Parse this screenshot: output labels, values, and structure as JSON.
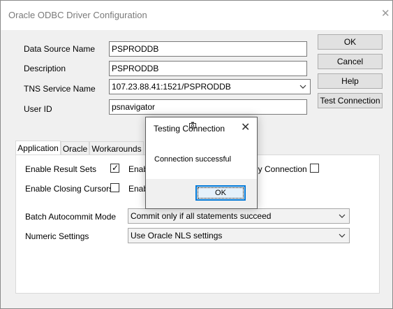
{
  "window": {
    "title": "Oracle ODBC Driver Configuration",
    "close_glyph": "✕"
  },
  "fields": {
    "data_source_name": {
      "label": "Data Source Name",
      "value": "PSPRODDB"
    },
    "description": {
      "label": "Description",
      "value": "PSPRODDB"
    },
    "tns_service_name": {
      "label": "TNS Service Name",
      "value": "107.23.88.41:1521/PSPRODDB"
    },
    "user_id": {
      "label": "User ID",
      "value": "psnavigator"
    }
  },
  "buttons": {
    "ok": "OK",
    "cancel": "Cancel",
    "help": "Help",
    "test_connection": "Test Connection"
  },
  "tabs": [
    {
      "label": "Application",
      "active": true
    },
    {
      "label": "Oracle"
    },
    {
      "label": "Workarounds"
    }
  ],
  "application": {
    "enable_result_sets": {
      "label": "Enable Result Sets",
      "checked": true
    },
    "enable_closing_cursors": {
      "label": "Enable Closing Cursors",
      "checked": false
    },
    "enab_1": "Enab",
    "enab_2": "Enab",
    "ly_connection": {
      "label": "ly Connection",
      "checked": false
    },
    "batch_autocommit": {
      "label": "Batch Autocommit Mode",
      "value": "Commit only if all statements succeed"
    },
    "numeric_settings": {
      "label": "Numeric Settings",
      "value": "Use Oracle NLS settings"
    }
  },
  "dialog": {
    "title": "Testing Connection",
    "message": "Connection successful",
    "ok_label": "OK",
    "close_glyph": "✕"
  },
  "check_glyph": "✓"
}
